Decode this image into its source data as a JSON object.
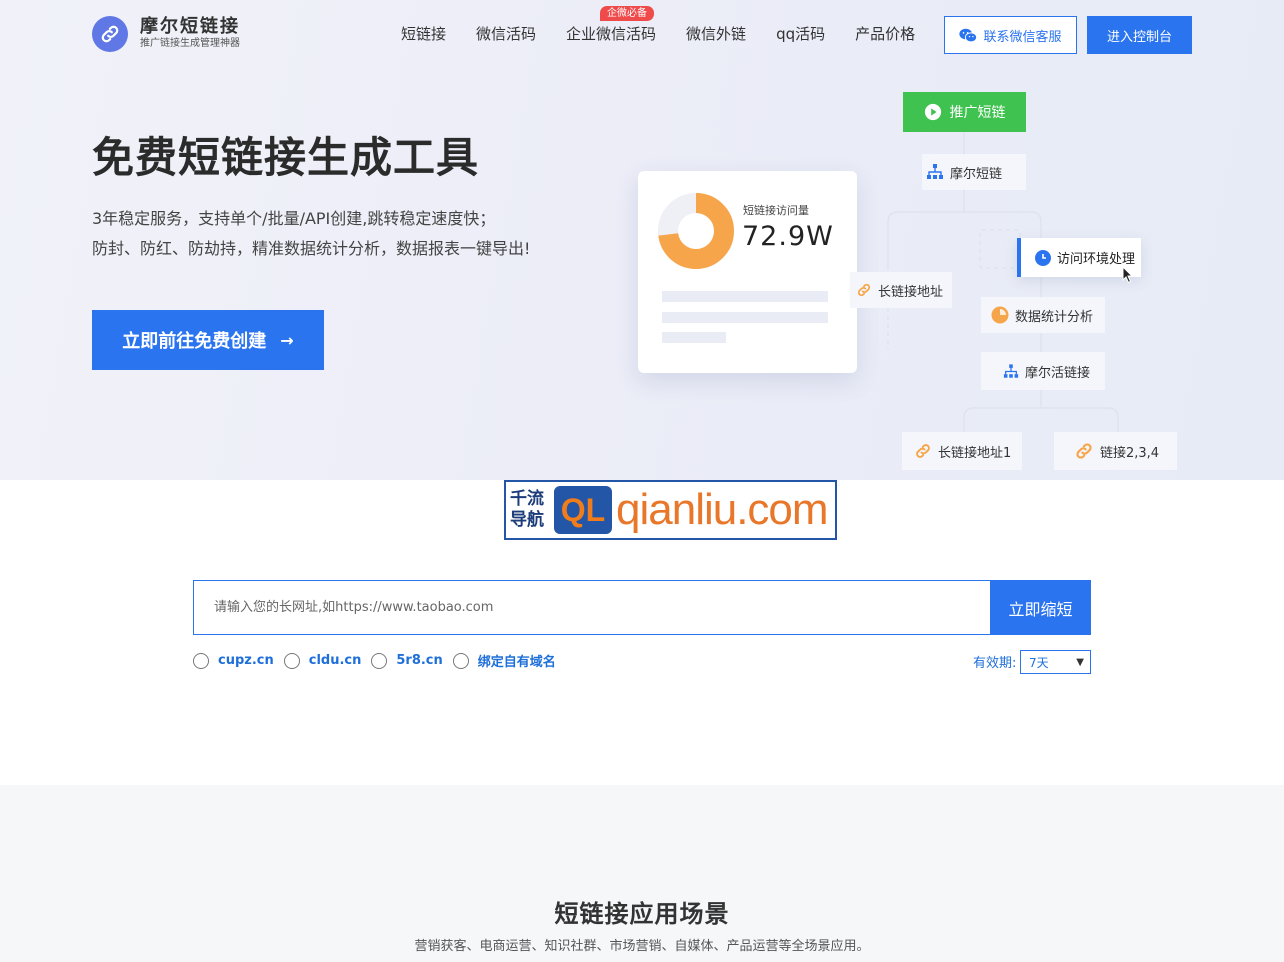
{
  "header": {
    "brand_name": "摩尔短链接",
    "brand_tagline": "推广链接生成管理神器",
    "nav": [
      {
        "label": "短链接"
      },
      {
        "label": "微信活码"
      },
      {
        "label": "企业微信活码",
        "badge": "企微必备"
      },
      {
        "label": "微信外链"
      },
      {
        "label": "qq活码"
      },
      {
        "label": "产品价格"
      }
    ],
    "contact_button": "联系微信客服",
    "console_button": "进入控制台"
  },
  "hero": {
    "title": "免费短链接生成工具",
    "desc_line1": "3年稳定服务，支持单个/批量/API创建,跳转稳定速度快；",
    "desc_line2": "防封、防红、防劫持，精准数据统计分析，数据报表一键导出!",
    "cta": "立即前往免费创建"
  },
  "illustration": {
    "card_label": "短链接访问量",
    "card_value": "72.9W",
    "donut_fill_percent": 72.9,
    "promote_button": "推广短链",
    "node_short": "摩尔短链",
    "node_env": "访问环境处理",
    "node_long": "长链接地址",
    "node_stats": "数据统计分析",
    "node_live": "摩尔活链接",
    "node_long1": "长链接地址1",
    "node_links": "链接2,3,4"
  },
  "watermark": {
    "cn": "千流导航",
    "ql": "QL",
    "url": "qianliu.com"
  },
  "shorten": {
    "placeholder": "请输入您的长网址,如https://www.taobao.com",
    "button": "立即缩短",
    "domains": [
      "cupz.cn",
      "cldu.cn",
      "5r8.cn",
      "绑定自有域名"
    ],
    "validity_label": "有效期:",
    "validity_value": "7天"
  },
  "scenes": {
    "title": "短链接应用场景",
    "subtitle": "营销获客、电商运营、知识社群、市场营销、自媒体、产品运营等全场景应用。"
  },
  "colors": {
    "primary": "#2b74f0",
    "green": "#3fc24f",
    "orange": "#f7a54a",
    "badge_red": "#ef4b4b"
  }
}
